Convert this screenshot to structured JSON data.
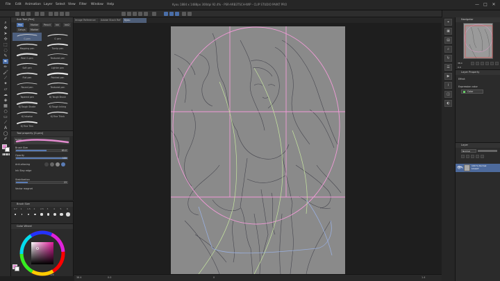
{
  "menu": {
    "items": [
      "File",
      "Edit",
      "Animation",
      "Layer",
      "Select",
      "View",
      "Filter",
      "Window",
      "Help"
    ],
    "title": "Kyou 1884 x 1488px 300dpi 92.4% - PSR-ARB3TSCH-WIP - CLIP STUDIO PAINT PRO"
  },
  "window_controls": {
    "minimize": "—",
    "maximize": "□",
    "close": "✕"
  },
  "document_tabs": [
    {
      "label": "Image Reference",
      "active": false
    },
    {
      "label": "Adobe Stock Ref",
      "active": false
    },
    {
      "label": "Kyou",
      "active": true
    }
  ],
  "subtool": {
    "header": "Sub Tool [Pen]",
    "tabs": [
      "Pen",
      "Marker",
      "Pencil",
      "Ink",
      "Ink2",
      "Celsys",
      "Marker"
    ],
    "brushes": [
      {
        "label": "G-pen",
        "active": true
      },
      {
        "label": "G pen",
        "active": false
      },
      {
        "label": "Mapping pen",
        "active": false
      },
      {
        "label": "Turnip pen",
        "active": false
      },
      {
        "label": "Real G-pen",
        "active": false
      },
      {
        "label": "Textured pen",
        "active": false
      },
      {
        "label": "Soft pen",
        "active": false
      },
      {
        "label": "Lighter pen",
        "active": false
      },
      {
        "label": "Flat pen",
        "active": false
      },
      {
        "label": "Pointed pen",
        "active": false
      },
      {
        "label": "Round pen",
        "active": false
      },
      {
        "label": "Textured pen",
        "active": false
      },
      {
        "label": "Tapered pen",
        "active": false
      },
      {
        "label": "KJ Tough Brush",
        "active": false
      },
      {
        "label": "KJ Tough Shade",
        "active": false
      },
      {
        "label": "KJ Tough Inking",
        "active": false
      },
      {
        "label": "KJ Inkwise",
        "active": false
      },
      {
        "label": "KJ Fine Think",
        "active": false
      },
      {
        "label": "KJ Fine Thin",
        "active": false
      }
    ]
  },
  "tool_property": {
    "header": "Tool property [G-pen]",
    "preview_label": "G-pen",
    "brush_size_label": "Brush Size",
    "brush_size_value": "65.0",
    "opacity_label": "Opacity",
    "opacity_value": "100",
    "opacity_fraction": 1.0,
    "brush_size_fraction": 0.6,
    "anti_aliasing_label": "Anti-aliasing",
    "stabilization_label": "Stabilization",
    "stabilization_value": "23",
    "stabilization_fraction": 0.23,
    "vector_magnet_label": "Vector magnet",
    "ink_edge_label": "Ink Stay edge"
  },
  "brush_size_panel": {
    "header": "Brush Size",
    "values": [
      "0.7",
      "1",
      "1.5",
      "2",
      "2.5",
      "3",
      "4",
      "5",
      "6"
    ]
  },
  "color_panel": {
    "header": "Color Wheel",
    "main_color": "#e48bd0",
    "sub_color": "#ffffff",
    "hue_value": "0",
    "rgb_value": "120"
  },
  "status": {
    "zoom": "38.4",
    "angle": "0.0",
    "coordinates": "0",
    "memory": "1.4"
  },
  "navigator": {
    "header": "Navigator",
    "zoom_value": "38.4",
    "angle_value": "0.0"
  },
  "layer_property": {
    "header": "Layer Property",
    "effect_label": "Effect",
    "expression_label": "Expression color",
    "expression_value": "Color"
  },
  "layer_panel": {
    "header": "Layer",
    "blend_mode": "Normal",
    "opacity": "100",
    "layers": [
      {
        "name": "100 % Normal\nLineart",
        "active": true
      }
    ]
  },
  "colors": {
    "accent": "#4a6ea8",
    "guide_pink": "#f29bd8",
    "guide_green": "#c8e8a0",
    "guide_blue": "#9ab0e0",
    "canvas_gray": "#8a8a8a"
  }
}
